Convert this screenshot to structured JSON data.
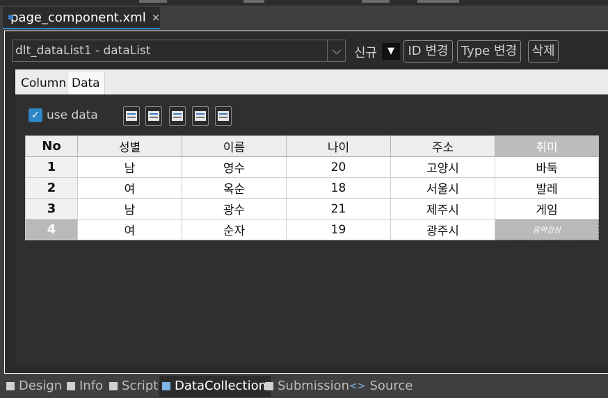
{
  "file_tab": {
    "label": "page_component.xml",
    "close": "×"
  },
  "dataset_combo": {
    "value": "dlt_dataList1 - dataList",
    "arrow": "⌵"
  },
  "toolbar": {
    "new_label": "신규",
    "new_arrow": "▼",
    "id_change": "ID 변경",
    "type_change": "Type 변경",
    "delete": "삭제"
  },
  "subtabs": [
    {
      "label": "Column"
    },
    {
      "label": "Data"
    }
  ],
  "use_data": {
    "checked": true,
    "label": "use data"
  },
  "grid": {
    "headers": [
      "No",
      "성별",
      "이름",
      "나이",
      "주소",
      "취미"
    ],
    "rows": [
      [
        "1",
        "남",
        "영수",
        "20",
        "고양시",
        "바둑"
      ],
      [
        "2",
        "여",
        "옥순",
        "18",
        "서울시",
        "발레"
      ],
      [
        "3",
        "남",
        "광수",
        "21",
        "제주시",
        "게임"
      ],
      [
        "4",
        "여",
        "순자",
        "19",
        "광주시",
        "음악감상"
      ]
    ]
  },
  "bottom_tabs": [
    {
      "label": "Design"
    },
    {
      "label": "Info"
    },
    {
      "label": "Script"
    },
    {
      "label": "DataCollection"
    },
    {
      "label": "Submission"
    },
    {
      "label": "Source"
    }
  ],
  "colors": {
    "accent": "#2b83c7",
    "checkbox": "#2f86c6",
    "selected": "#b9b9b9"
  }
}
